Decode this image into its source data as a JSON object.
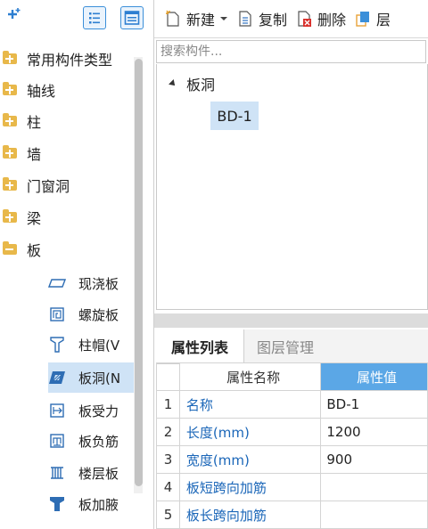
{
  "left_panel": {
    "tree": [
      {
        "label": "常用构件类型"
      },
      {
        "label": "轴线"
      },
      {
        "label": "柱"
      },
      {
        "label": "墙"
      },
      {
        "label": "门窗洞"
      },
      {
        "label": "梁"
      },
      {
        "label": "板"
      }
    ],
    "sub_items": [
      {
        "label": "现浇板",
        "icon": "cast-slab-icon"
      },
      {
        "label": "螺旋板",
        "icon": "spiral-slab-icon"
      },
      {
        "label": "柱帽(V",
        "icon": "column-cap-icon"
      },
      {
        "label": "板洞(N",
        "icon": "slab-hole-icon",
        "selected": true
      },
      {
        "label": "板受力",
        "icon": "slab-force-rebar-icon"
      },
      {
        "label": "板负筋",
        "icon": "slab-negative-rebar-icon"
      },
      {
        "label": "楼层板",
        "icon": "floor-slab-icon"
      },
      {
        "label": "板加腋",
        "icon": "slab-haunch-icon"
      }
    ]
  },
  "toolbar": {
    "new_label": "新建",
    "copy_label": "复制",
    "delete_label": "删除",
    "layer_label": "层"
  },
  "search": {
    "placeholder": "搜索构件..."
  },
  "component_tree": {
    "root_label": "板洞",
    "child_label": "BD-1"
  },
  "tabs": [
    {
      "label": "属性列表",
      "active": true
    },
    {
      "label": "图层管理",
      "active": false
    }
  ],
  "properties": {
    "headers": {
      "name": "属性名称",
      "value": "属性值"
    },
    "rows": [
      {
        "index": "1",
        "name": "名称",
        "value": "BD-1"
      },
      {
        "index": "2",
        "name": "长度(mm)",
        "value": "1200"
      },
      {
        "index": "3",
        "name": "宽度(mm)",
        "value": "900"
      },
      {
        "index": "4",
        "name": "板短跨向加筋",
        "value": ""
      },
      {
        "index": "5",
        "name": "板长跨向加筋",
        "value": ""
      }
    ]
  },
  "colors": {
    "accent": "#5ba7e6",
    "selection": "#cfe3f6",
    "link": "#1a66b8",
    "folder": "#e8b84a"
  }
}
